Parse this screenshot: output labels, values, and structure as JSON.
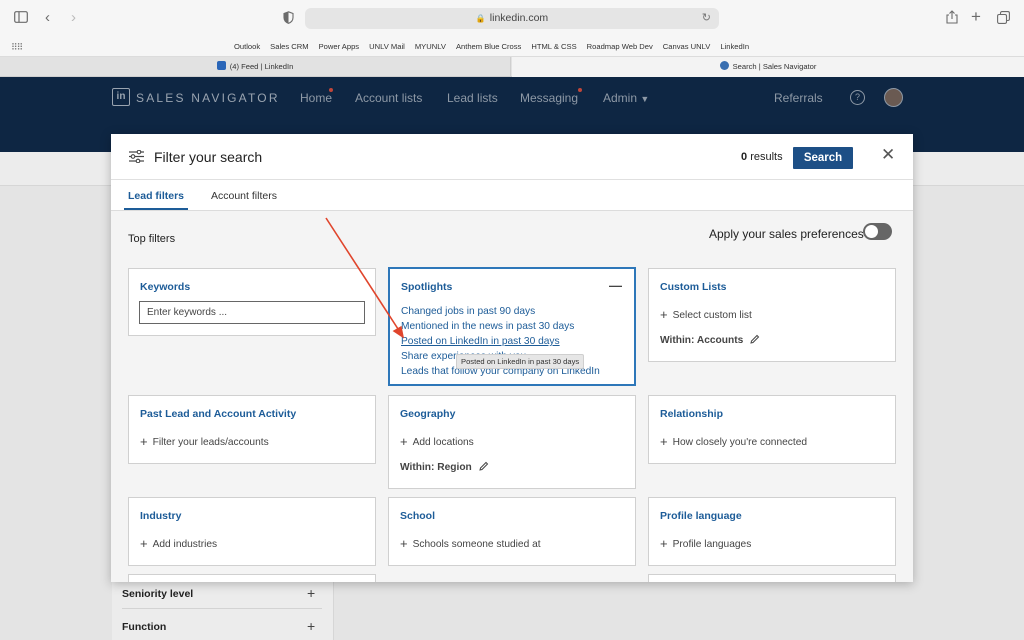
{
  "browser": {
    "url": "linkedin.com",
    "favorites": [
      "Outlook",
      "Sales CRM",
      "Power Apps",
      "UNLV Mail",
      "MYUNLV",
      "Anthem Blue Cross",
      "HTML & CSS",
      "Roadmap Web Dev",
      "Canvas UNLV",
      "LinkedIn"
    ],
    "tabs": [
      {
        "label": "(4) Feed | LinkedIn",
        "active": false
      },
      {
        "label": "Search | Sales Navigator",
        "active": true
      }
    ]
  },
  "app": {
    "brand": "SALES NAVIGATOR",
    "nav": [
      "Home",
      "Account lists",
      "Lead lists",
      "Messaging",
      "Admin"
    ],
    "referrals": "Referrals"
  },
  "background_panel": {
    "items": [
      "Seniority level",
      "Function"
    ]
  },
  "modal": {
    "title": "Filter your search",
    "results_count": "0",
    "results_label": "results",
    "search_button": "Search",
    "tabs": [
      "Lead filters",
      "Account filters"
    ],
    "top_filters_label": "Top filters",
    "preferences_label": "Apply your sales preferences",
    "preferences_on": false,
    "cards": {
      "keywords": {
        "title": "Keywords",
        "placeholder": "Enter keywords ..."
      },
      "spotlights": {
        "title": "Spotlights",
        "links": [
          "Changed jobs in past 90 days",
          "Mentioned in the news in past 30 days",
          "Posted on LinkedIn in past 30 days",
          "Share experiences with you",
          "Leads that follow your company on LinkedIn"
        ],
        "tooltip": "Posted on LinkedIn in past 30 days"
      },
      "custom_lists": {
        "title": "Custom Lists",
        "action": "Select custom list",
        "within": "Within: Accounts"
      },
      "past_activity": {
        "title": "Past Lead and Account Activity",
        "action": "Filter your leads/accounts"
      },
      "geography": {
        "title": "Geography",
        "action": "Add locations",
        "within": "Within: Region"
      },
      "relationship": {
        "title": "Relationship",
        "action": "How closely you're connected"
      },
      "industry": {
        "title": "Industry",
        "action": "Add industries"
      },
      "school": {
        "title": "School",
        "action": "Schools someone studied at"
      },
      "profile_language": {
        "title": "Profile language",
        "action": "Profile languages"
      }
    }
  },
  "colors": {
    "accent": "#1d5c98",
    "search_button": "#1d4f86",
    "arrow": "#e0452c",
    "nav_bg": "#0e2643"
  }
}
